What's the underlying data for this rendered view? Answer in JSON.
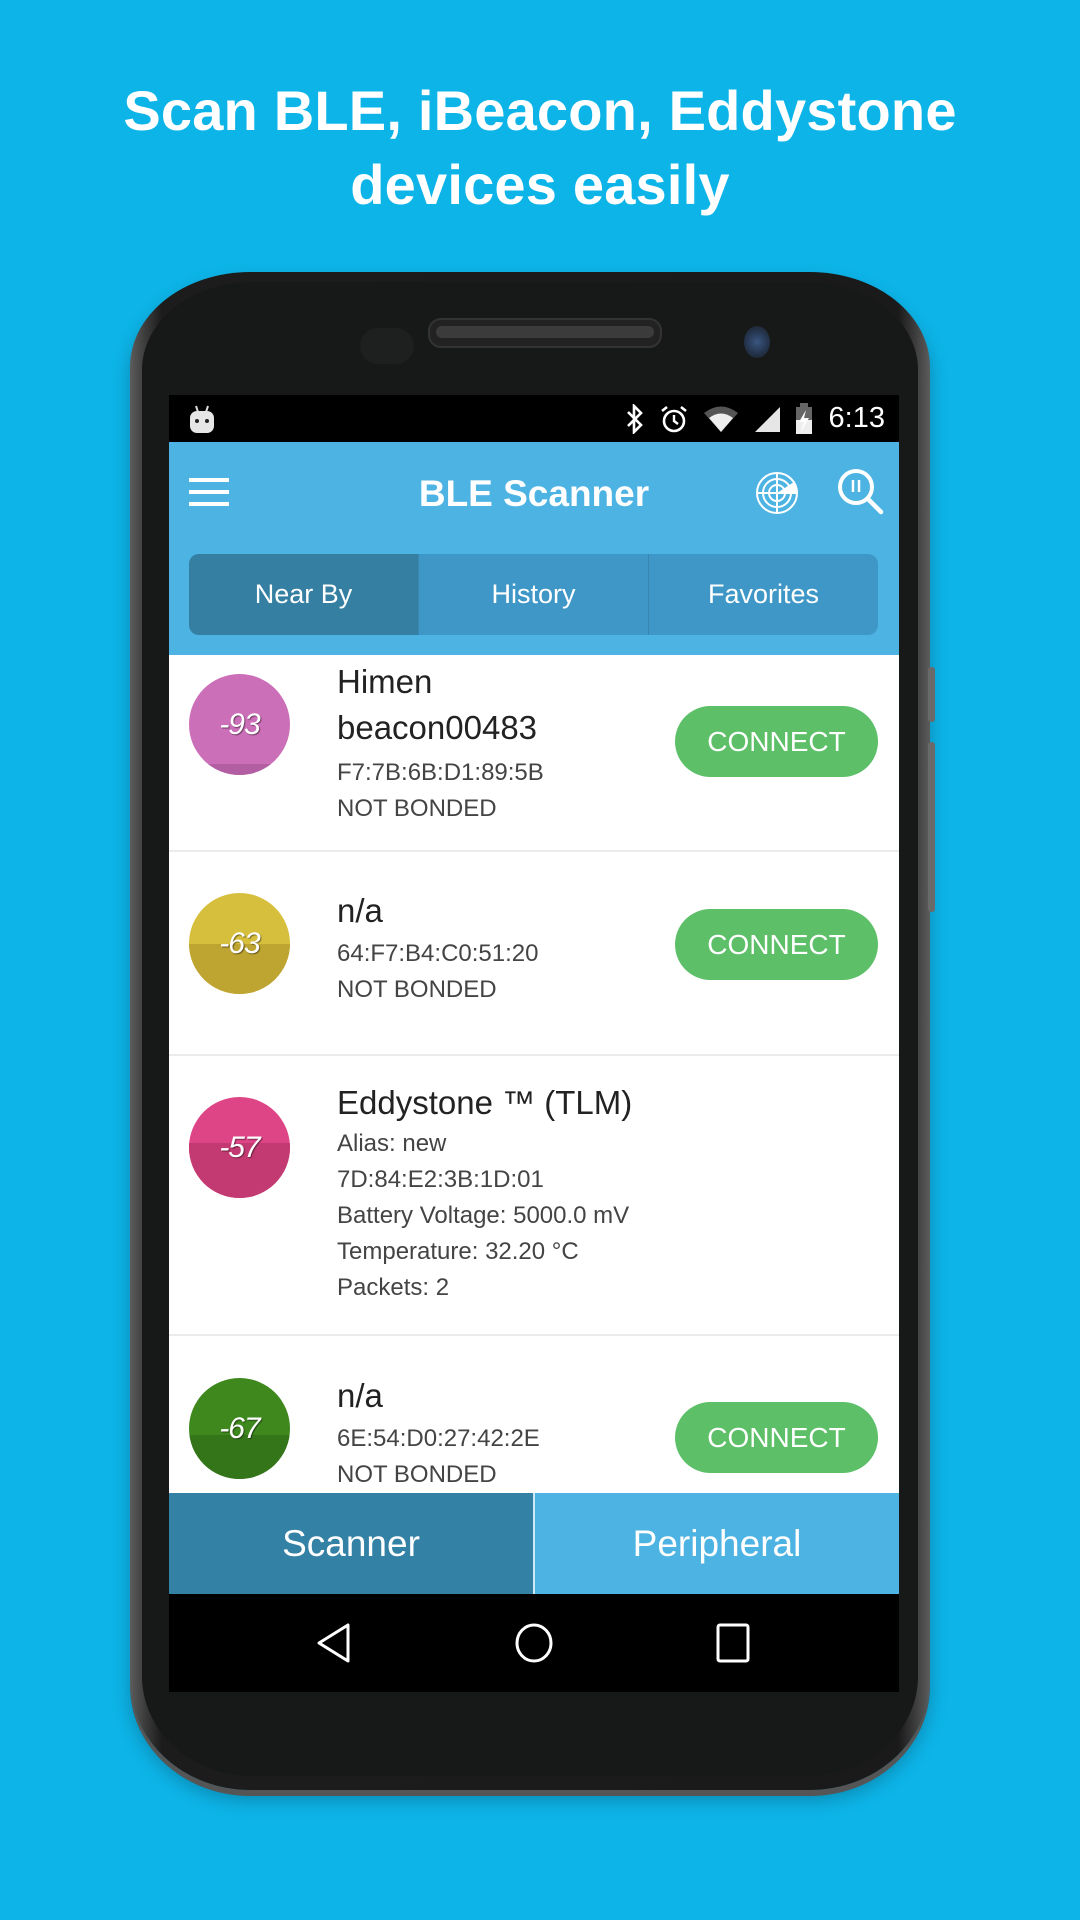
{
  "headline": {
    "line1": "Scan BLE, iBeacon, Eddystone",
    "line2": "devices easily"
  },
  "status_bar": {
    "notification_icon": "android-icon",
    "icons": [
      "bluetooth-icon",
      "alarm-icon",
      "wifi-icon",
      "signal-icon",
      "battery-charging-icon"
    ],
    "time": "6:13"
  },
  "app_bar": {
    "menu_icon": "hamburger-menu-icon",
    "title": "BLE Scanner",
    "radar_icon": "radar-icon",
    "search_icon": "search-pause-icon"
  },
  "tabs": [
    {
      "label": "Near By",
      "active": true
    },
    {
      "label": "History",
      "active": false
    },
    {
      "label": "Favorites",
      "active": false
    }
  ],
  "devices": [
    {
      "rssi": "-93",
      "color_top": "#CB6FB8",
      "color_bottom": "#B35DA2",
      "name": "Himen beacon00483",
      "lines": [
        "F7:7B:6B:D1:89:5B",
        "NOT BONDED"
      ],
      "action": "CONNECT"
    },
    {
      "rssi": "-63",
      "color_top": "#D7BF3E",
      "color_bottom": "#BEA431",
      "name": "n/a",
      "lines": [
        "64:F7:B4:C0:51:20",
        "NOT BONDED"
      ],
      "action": "CONNECT"
    },
    {
      "rssi": "-57",
      "color_top": "#DE4587",
      "color_bottom": "#C33A72",
      "name": "Eddystone ™ (TLM)",
      "lines": [
        "Alias: new",
        "7D:84:E2:3B:1D:01",
        "Battery Voltage: 5000.0 mV",
        "Temperature: 32.20 °C",
        "Packets: 2"
      ],
      "action": null
    },
    {
      "rssi": "-67",
      "color_top": "#3E881E",
      "color_bottom": "#34751A",
      "name": "n/a",
      "lines": [
        "6E:54:D0:27:42:2E",
        "NOT BONDED"
      ],
      "action": "CONNECT"
    }
  ],
  "bottom_nav": {
    "scanner": "Scanner",
    "peripheral": "Peripheral"
  },
  "system_nav": {
    "back": "back-icon",
    "home": "home-icon",
    "recents": "recents-icon"
  },
  "colors": {
    "background": "#0DB4E8",
    "app_bar": "#4DB3E3",
    "tab_active": "#357FA3",
    "connect": "#5DBF67"
  }
}
